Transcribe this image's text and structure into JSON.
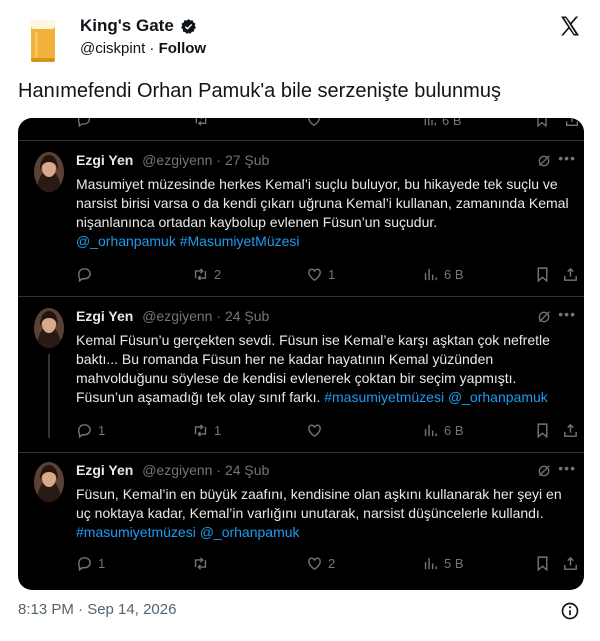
{
  "author": {
    "name": "King's Gate",
    "handle": "@ciskpint",
    "separator": "·",
    "follow_label": "Follow"
  },
  "tweet_text": "Hanımefendi Orhan Pamuk'a bile serzenişte bulunmuş",
  "embedded": {
    "top_row": {
      "views": "6 B"
    },
    "tweets": [
      {
        "name": "Ezgi Yen",
        "handle": "@ezgiyenn",
        "dot": "·",
        "date": "27 Şub",
        "text": "Masumiyet müzesinde herkes Kemal’i suçlu buluyor, bu hikayede tek suçlu ve narsist birisi varsa o da kendi çıkarı uğruna Kemal’i kullanan, zamanında Kemal nişanlanınca ortadan kaybolup evlenen Füsun’un suçudur.",
        "tags": "@_orhanpamuk #MasumiyetMüzesi",
        "replies": "",
        "retweets": "2",
        "likes": "1",
        "views": "6 B"
      },
      {
        "name": "Ezgi Yen",
        "handle": "@ezgiyenn",
        "dot": "·",
        "date": "24 Şub",
        "text": "Kemal Füsun’u gerçekten sevdi. Füsun ise Kemal’e karşı aşktan çok nefretle baktı... Bu romanda Füsun her ne kadar hayatının Kemal yüzünden mahvolduğunu söylese de kendisi evlenerek çoktan bir seçim yapmıştı. Füsun’un aşamadığı tek olay sınıf farkı.",
        "tags": "#masumiyetmüzesi @_orhanpamuk",
        "replies": "1",
        "retweets": "1",
        "likes": "",
        "views": "6 B"
      },
      {
        "name": "Ezgi Yen",
        "handle": "@ezgiyenn",
        "dot": "·",
        "date": "24 Şub",
        "text": "Füsun, Kemal’in en büyük zaafını, kendisine olan aşkını kullanarak her şeyi en uç noktaya kadar, Kemal’in varlığını unutarak, narsist düşüncelerle kullandı.",
        "tags": "#masumiyetmüzesi @_orhanpamuk",
        "replies": "1",
        "retweets": "",
        "likes": "2",
        "views": "5 B"
      }
    ]
  },
  "footer": {
    "timestamp": "8:13 PM · Sep 14, 2026"
  },
  "icons": {
    "verified": "verified-badge-icon",
    "x_logo": "x-logo-icon",
    "reply": "reply-icon",
    "retweet": "retweet-icon",
    "like": "heart-icon",
    "views": "views-icon",
    "bookmark": "bookmark-icon",
    "share": "share-icon",
    "grok": "grok-icon",
    "more": "more-icon",
    "info": "info-icon"
  },
  "colors": {
    "link": "#1d9bf0",
    "dark_bg": "#000000",
    "muted": "#71767b"
  }
}
